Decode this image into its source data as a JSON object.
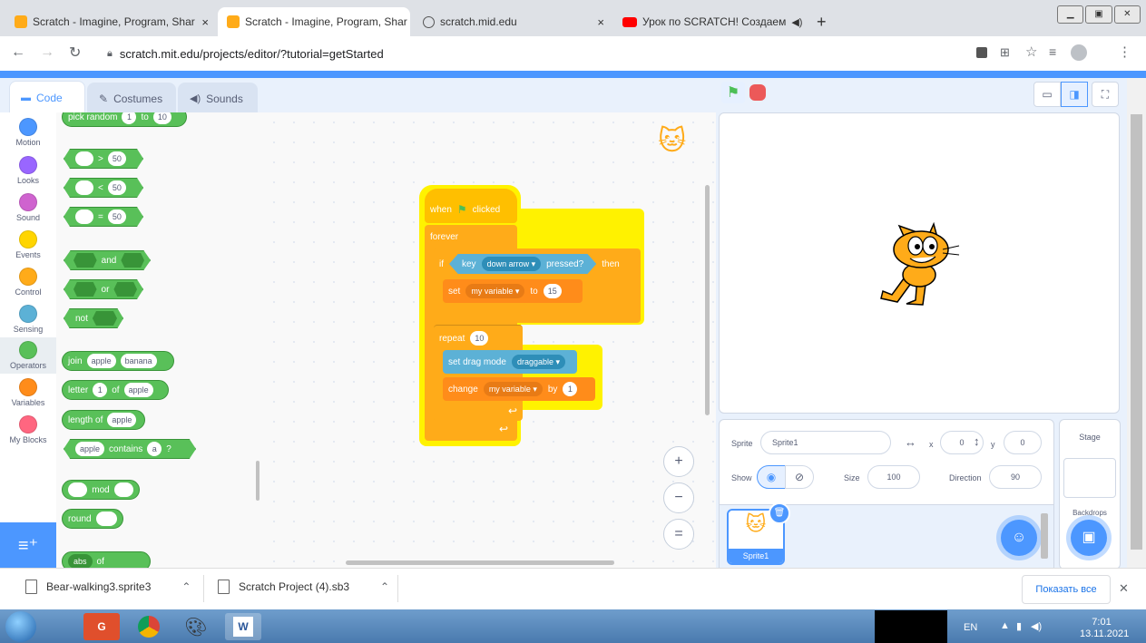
{
  "browser": {
    "tabs": [
      {
        "title": "Scratch - Imagine, Program, Shar",
        "close": "×"
      },
      {
        "title": "Scratch - Imagine, Program, Shar",
        "close": "×"
      },
      {
        "title": "scratch.mid.edu",
        "close": "×"
      },
      {
        "title": "Урок по SCRATCH! Создаем",
        "close": "×"
      }
    ],
    "new_tab": "+",
    "url": "scratch.mit.edu/projects/editor/?tutorial=getStarted"
  },
  "editor": {
    "tabs": {
      "code": "Code",
      "costumes": "Costumes",
      "sounds": "Sounds"
    },
    "categories": [
      {
        "label": "Motion",
        "color": "#4c97ff"
      },
      {
        "label": "Looks",
        "color": "#9966ff"
      },
      {
        "label": "Sound",
        "color": "#cf63cf"
      },
      {
        "label": "Events",
        "color": "#ffd500"
      },
      {
        "label": "Control",
        "color": "#ffab19"
      },
      {
        "label": "Sensing",
        "color": "#5cb1d6"
      },
      {
        "label": "Operators",
        "color": "#59c059"
      },
      {
        "label": "Variables",
        "color": "#ff8c1a"
      },
      {
        "label": "My Blocks",
        "color": "#ff6680"
      }
    ],
    "palette": {
      "pick_random": "pick random",
      "pick_from": "1",
      "pick_to_word": "to",
      "pick_to": "10",
      "gt_symbol": ">",
      "gt_value": "50",
      "lt_symbol": "<",
      "lt_value": "50",
      "eq_symbol": "=",
      "eq_value": "50",
      "and": "and",
      "or": "or",
      "not": "not",
      "join": "join",
      "join_a": "apple",
      "join_b": "banana",
      "letter": "letter",
      "letter_n": "1",
      "letter_of": "of",
      "letter_word": "apple",
      "length_of": "length of",
      "length_word": "apple",
      "contains_word": "apple",
      "contains": "contains",
      "contains_letter": "a",
      "contains_q": "?",
      "mod": "mod",
      "round": "round",
      "abs": "abs",
      "abs_of": "of"
    },
    "script": {
      "when": "when",
      "clicked": "clicked",
      "forever": "forever",
      "if": "if",
      "key": "key",
      "key_option": "down arrow ▾",
      "pressed": "pressed?",
      "then": "then",
      "set": "set",
      "set_var": "my variable ▾",
      "set_to": "to",
      "set_value": "15",
      "repeat": "repeat",
      "repeat_value": "10",
      "drag_mode": "set drag mode",
      "drag_option": "draggable ▾",
      "change": "change",
      "change_var": "my variable ▾",
      "change_by": "by",
      "change_value": "1"
    },
    "zoom": {
      "in": "+",
      "out": "−",
      "reset": "="
    }
  },
  "sprite_info": {
    "sprite_label": "Sprite",
    "sprite_name": "Sprite1",
    "x_label": "x",
    "x_value": "0",
    "y_label": "y",
    "y_value": "0",
    "show_label": "Show",
    "size_label": "Size",
    "size_value": "100",
    "direction_label": "Direction",
    "direction_value": "90",
    "thumb_name": "Sprite1"
  },
  "stage_panel": {
    "title": "Stage",
    "backdrops": "Backdrops"
  },
  "downloads": {
    "items": [
      {
        "name": "Bear-walking3.sprite3"
      },
      {
        "name": "Scratch Project (4).sb3"
      }
    ],
    "show_all": "Показать все",
    "close": "✕"
  },
  "taskbar": {
    "lang": "EN",
    "time": "7:01",
    "date": "13.11.2021"
  }
}
